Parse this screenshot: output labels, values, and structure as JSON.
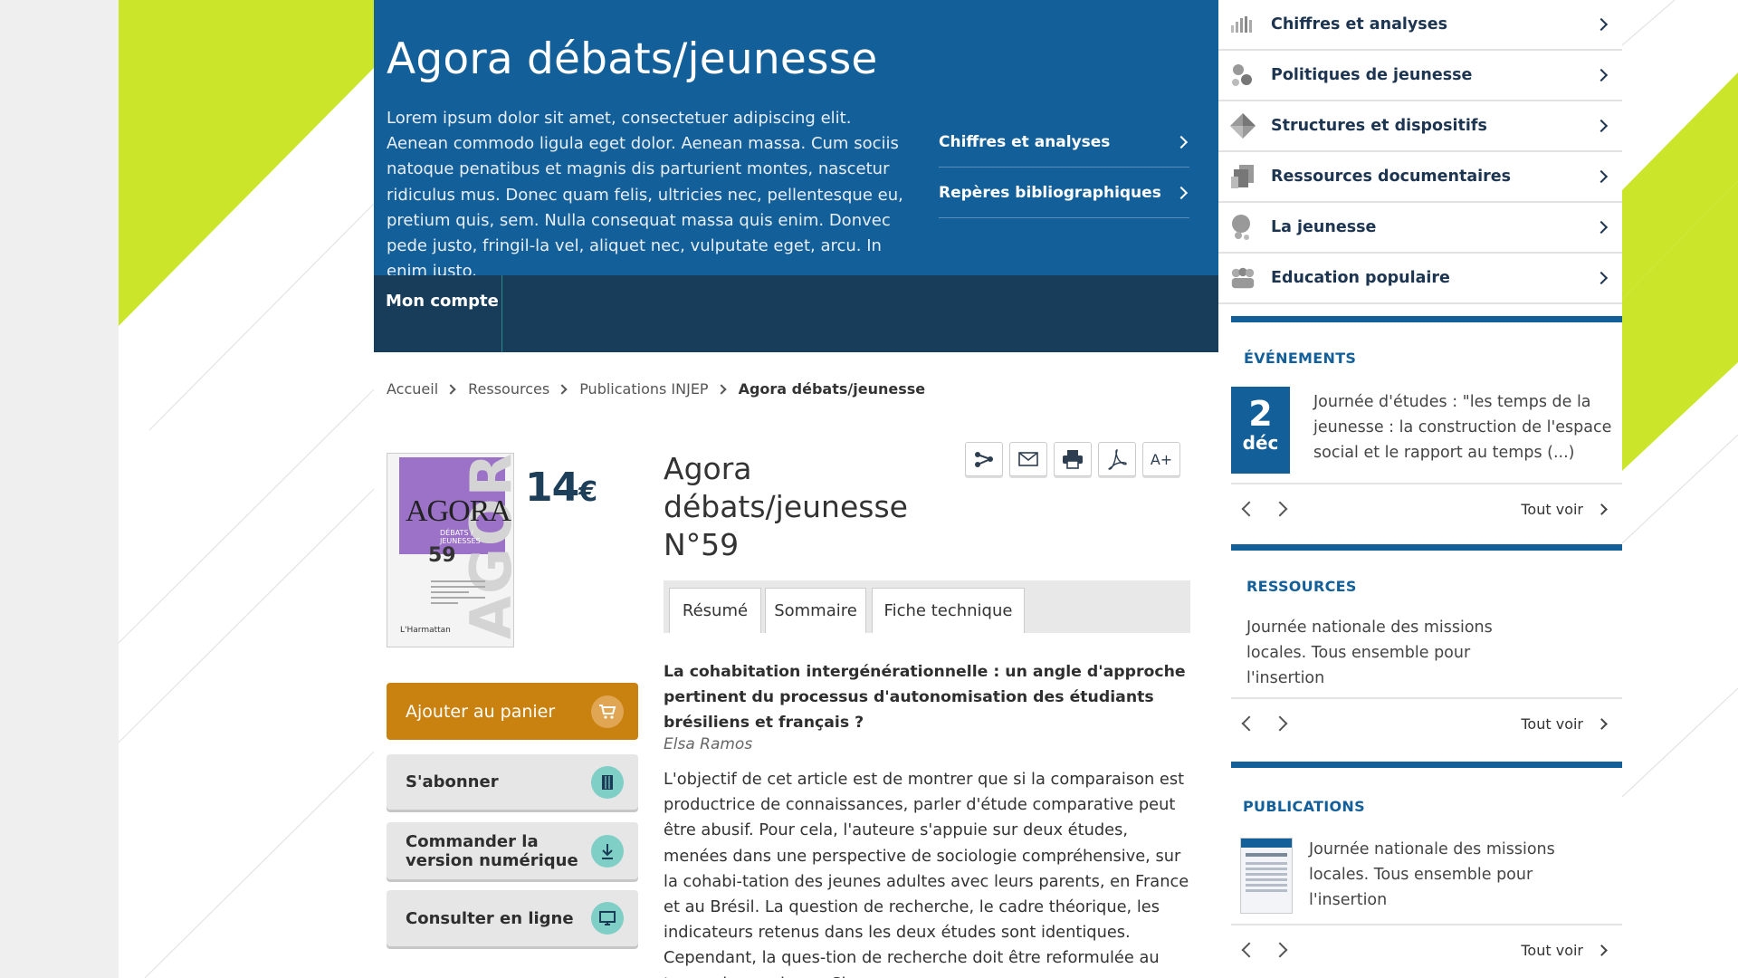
{
  "hero": {
    "title": "Agora débats/jeunesse",
    "description": "Lorem ipsum dolor sit amet, consectetuer adipiscing elit. Aenean commodo ligula eget dolor. Aenean massa. Cum sociis natoque penatibus et magnis dis parturient montes, nascetur ridiculus mus. Donec quam felis, ultricies nec, pellentesque eu, pretium quis, sem. Nulla consequat massa quis enim. Donvec pede justo, fringil-la vel, aliquet nec, vulputate eget, arcu. In enim justo.",
    "links": [
      "Chiffres et analyses",
      "Repères bibliographiques"
    ]
  },
  "navbar": {
    "account": "Mon compte"
  },
  "breadcrumb": [
    "Accueil",
    "Ressources",
    "Publications INJEP",
    "Agora débats/jeunesse"
  ],
  "product": {
    "cover": {
      "title": "AGORA",
      "subtitle": "DÉBATS / JEUNESSES",
      "number": "59",
      "publisher": "L'Harmattan"
    },
    "price": "14",
    "currency": "€",
    "buttons": {
      "cart": "Ajouter au panier",
      "subscribe": "S'abonner",
      "digital_line1": "Commander la",
      "digital_line2": "version numérique",
      "online": "Consulter en ligne"
    }
  },
  "article": {
    "title_line1": "Agora",
    "title_line2": "débats/jeunesse",
    "title_line3": "N°59",
    "tools": [
      "share-icon",
      "mail-icon",
      "print-icon",
      "pdf-icon",
      "font-size-icon"
    ],
    "font_size_label": "A+",
    "tabs": [
      "Résumé",
      "Sommaire",
      "Fiche technique"
    ],
    "heading": "La cohabitation intergénérationnelle : un angle d'approche pertinent du processus d'autonomisation des étudiants brésiliens et français ?",
    "author": "Elsa Ramos",
    "body": "L'objectif de cet article est de montrer que si la comparaison est productrice de connaissances, parler d'étude comparative peut être abusif. Pour cela, l'auteure s'appuie sur deux études, menées dans une perspective de sociologie compréhensive, sur la cohabi-tation des jeunes adultes avec leurs parents, en France et au Brésil. La question de recherche, le cadre théorique, les indicateurs retenus dans les deux études sont identiques. Cependant, la ques-tion de recherche doit être reformulée au terme des analyses. Si"
  },
  "sidebar": {
    "menu": [
      {
        "label": "Chiffres et analyses",
        "icon": "bar-chart-icon"
      },
      {
        "label": "Politiques de jeunesse",
        "icon": "molecule-icon"
      },
      {
        "label": "Structures et dispositifs",
        "icon": "diamond-icon"
      },
      {
        "label": "Ressources documentaires",
        "icon": "documents-icon"
      },
      {
        "label": "La jeunesse",
        "icon": "person-bubble-icon"
      },
      {
        "label": "Education populaire",
        "icon": "people-icon"
      }
    ],
    "events": {
      "title": "ÉVÉNEMENTS",
      "day": "2",
      "month": "déc",
      "text": "Journée d'études : \"les temps de la jeunesse : la construction de l'espace social et le rapport au temps (...)",
      "see_all": "Tout voir"
    },
    "resources": {
      "title": "RESSOURCES",
      "text": "Journée nationale des missions locales. Tous ensemble pour l'insertion",
      "see_all": "Tout voir"
    },
    "publications": {
      "title": "PUBLICATIONS",
      "text": "Journée nationale des missions locales. Tous ensemble pour l'insertion",
      "see_all": "Tout voir"
    }
  },
  "colors": {
    "accent_green": "#cbe62a",
    "primary_blue": "#135f9a",
    "dark_navy": "#173d5b",
    "cart_orange": "#c9820f"
  }
}
